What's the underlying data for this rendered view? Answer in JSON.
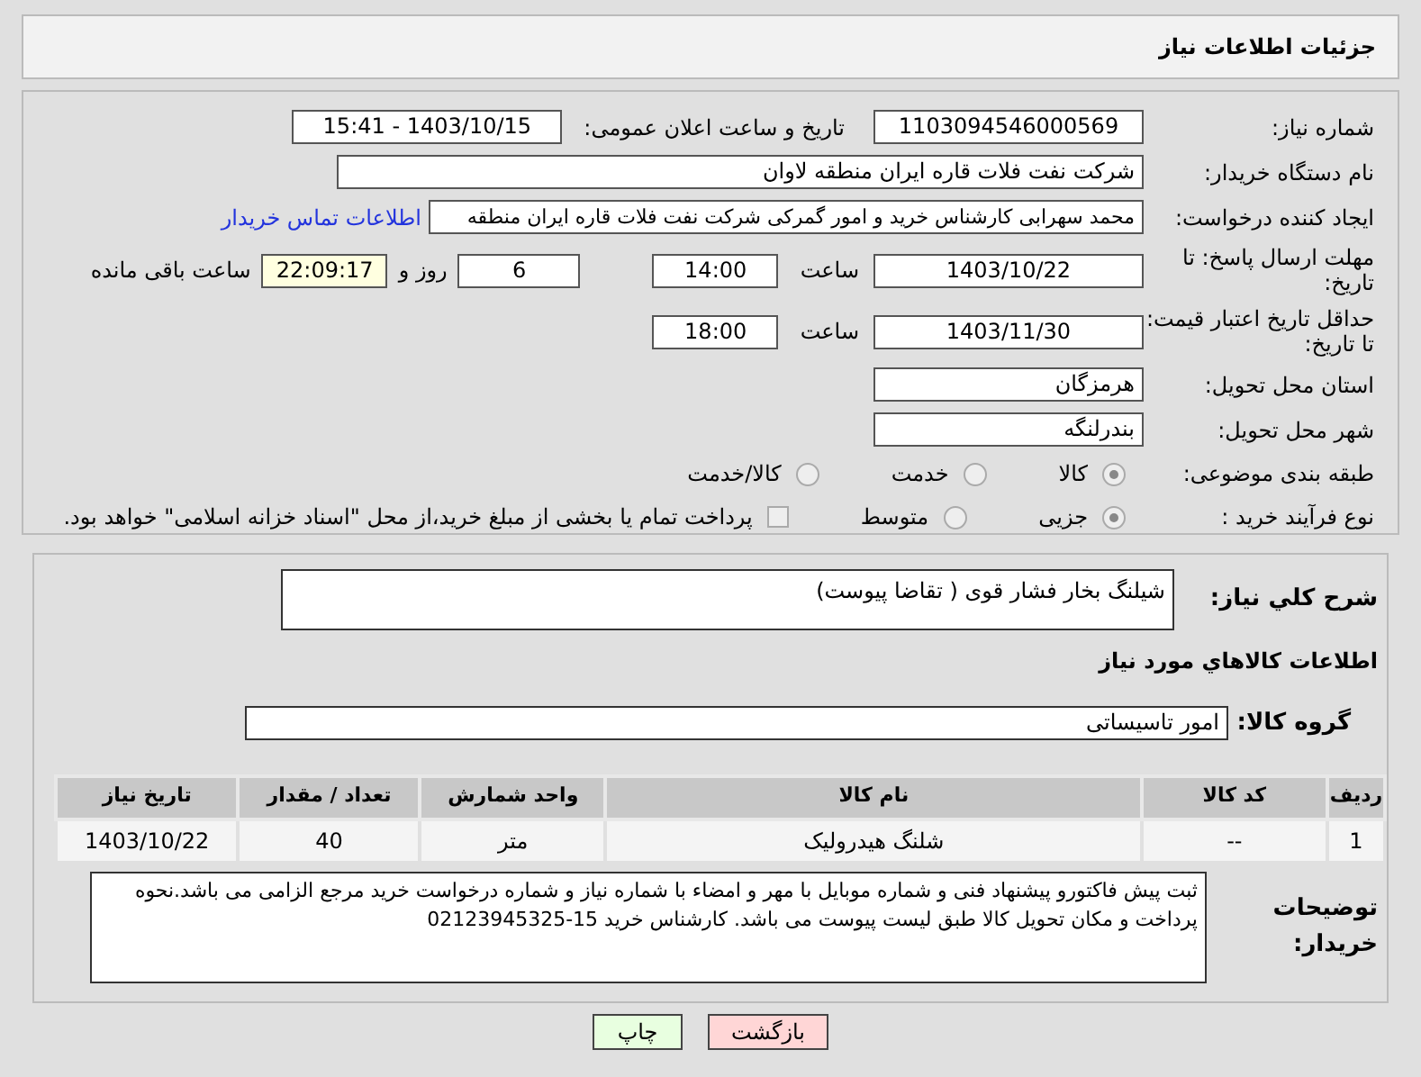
{
  "header": {
    "title": "جزئیات اطلاعات نیاز"
  },
  "need_number": {
    "label": "شماره نیاز:",
    "value": "1103094546000569"
  },
  "announce": {
    "label": "تاریخ و ساعت اعلان عمومی:",
    "value": "1403/10/15 - 15:41"
  },
  "buyer_org": {
    "label": "نام دستگاه خریدار:",
    "value": "شرکت نفت فلات قاره ایران منطقه لاوان"
  },
  "requester": {
    "label": "ایجاد کننده درخواست:",
    "value": "محمد سهرابی کارشناس خرید و امور گمرکی شرکت نفت فلات قاره ایران منطقه",
    "link": "اطلاعات تماس خریدار"
  },
  "reply_deadline": {
    "label": "مهلت ارسال پاسخ: تا تاریخ:",
    "date": "1403/10/22",
    "time_label": "ساعت",
    "time": "14:00",
    "days": "6",
    "days_label": "روز و",
    "remaining": "22:09:17",
    "remaining_label": "ساعت باقی مانده"
  },
  "price_validity": {
    "label": "حداقل تاریخ اعتبار قیمت: تا تاریخ:",
    "date": "1403/11/30",
    "time_label": "ساعت",
    "time": "18:00"
  },
  "province": {
    "label": "استان محل تحویل:",
    "value": "هرمزگان"
  },
  "city": {
    "label": "شهر محل تحویل:",
    "value": "بندرلنگه"
  },
  "category": {
    "label": "طبقه بندی موضوعی:",
    "options": [
      {
        "label": "کالا",
        "selected": true
      },
      {
        "label": "خدمت",
        "selected": false
      },
      {
        "label": "کالا/خدمت",
        "selected": false
      }
    ]
  },
  "process": {
    "label": "نوع فرآیند خرید :",
    "options": [
      {
        "label": "جزیی",
        "selected": true
      },
      {
        "label": "متوسط",
        "selected": false
      }
    ],
    "payment": {
      "label": "پرداخت تمام یا بخشی از مبلغ خرید،از محل \"اسناد خزانه اسلامی\" خواهد بود.",
      "checked": false
    }
  },
  "description": {
    "label": "شرح کلي نیاز:",
    "value": "شیلنگ بخار فشار قوی ( تقاضا پیوست)"
  },
  "goods_title": "اطلاعات کالاهاي مورد نیاز",
  "goods_group": {
    "label": "گروه کالا:",
    "value": "امور تاسیساتی"
  },
  "table": {
    "columns": [
      "ردیف",
      "کد کالا",
      "نام کالا",
      "واحد شمارش",
      "تعداد / مقدار",
      "تاریخ نیاز"
    ],
    "rows": [
      [
        "1",
        "--",
        "شلنگ هیدرولیک",
        "متر",
        "40",
        "1403/10/22"
      ]
    ]
  },
  "notes": {
    "label": "توضیحات خریدار:",
    "value": "ثبت پیش فاکتورو پیشنهاد فنی و شماره موبایل با مهر و امضاء با شماره نیاز و شماره درخواست خرید مرجع الزامی می باشد.نحوه پرداخت و مکان تحویل کالا طبق لیست پیوست می باشد. کارشناس خرید 15-02123945325"
  },
  "buttons": [
    {
      "label": "بازگشت",
      "kind": "back"
    },
    {
      "label": "چاپ",
      "kind": "print"
    }
  ]
}
